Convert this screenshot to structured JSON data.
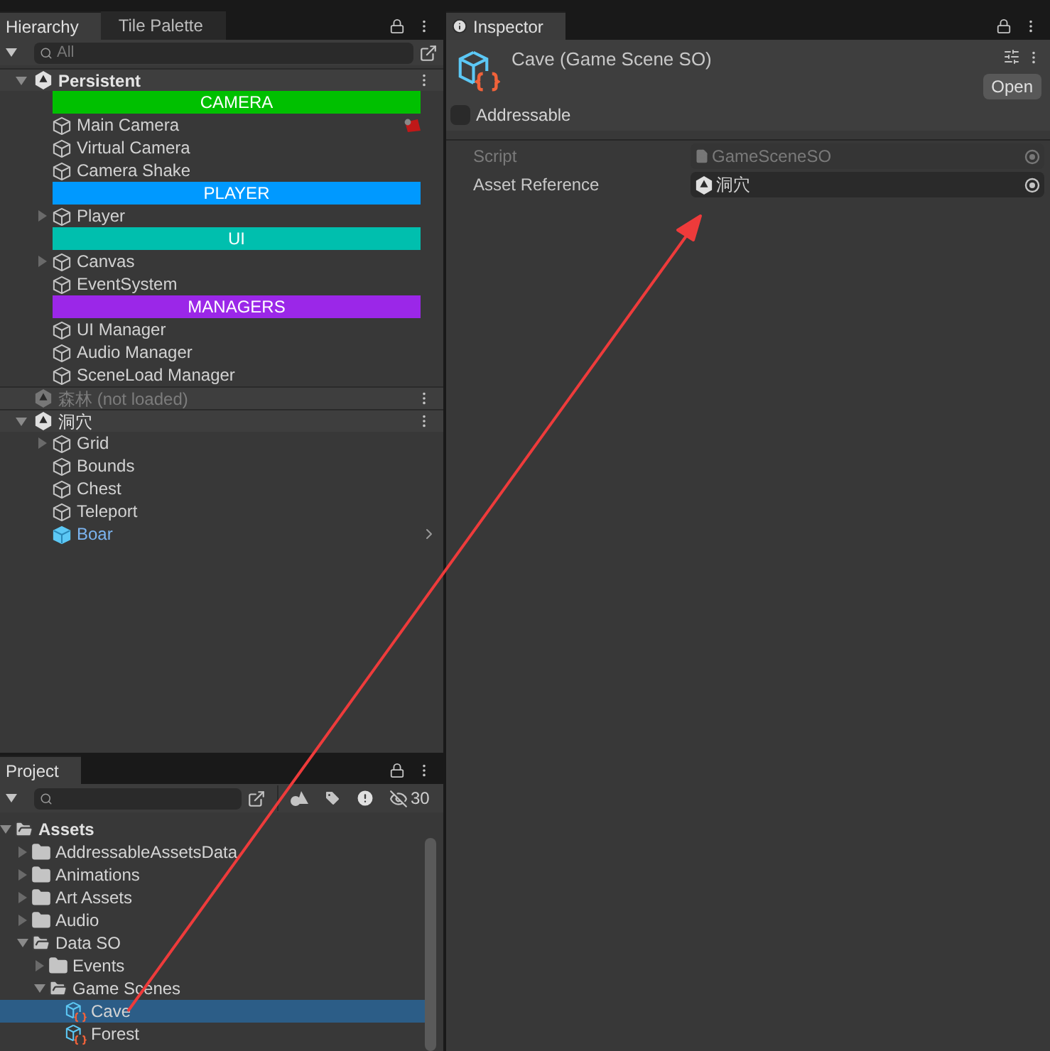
{
  "hierarchy": {
    "tabs": [
      {
        "label": "Hierarchy",
        "selected": true
      },
      {
        "label": "Tile Palette",
        "selected": false
      }
    ],
    "search": {
      "placeholder": "All"
    },
    "scenes": [
      {
        "name": "Persistent",
        "loaded": true,
        "expanded": true,
        "children": [
          {
            "kind": "header",
            "label": "CAMERA",
            "color": "#00c000"
          },
          {
            "kind": "object",
            "name": "Main Camera",
            "expandable": false,
            "prefab": false,
            "gizmo": true
          },
          {
            "kind": "object",
            "name": "Virtual Camera",
            "expandable": false,
            "prefab": false,
            "gizmo": false
          },
          {
            "kind": "object",
            "name": "Camera Shake",
            "expandable": false,
            "prefab": false,
            "gizmo": false
          },
          {
            "kind": "header",
            "label": "PLAYER",
            "color": "#0099ff"
          },
          {
            "kind": "object",
            "name": "Player",
            "expandable": true,
            "prefab": false,
            "gizmo": false
          },
          {
            "kind": "header",
            "label": "UI",
            "color": "#00bfae"
          },
          {
            "kind": "object",
            "name": "Canvas",
            "expandable": true,
            "prefab": false,
            "gizmo": false
          },
          {
            "kind": "object",
            "name": "EventSystem",
            "expandable": false,
            "prefab": false,
            "gizmo": false
          },
          {
            "kind": "header",
            "label": "MANAGERS",
            "color": "#9b27e8"
          },
          {
            "kind": "object",
            "name": "UI Manager",
            "expandable": false,
            "prefab": false,
            "gizmo": false
          },
          {
            "kind": "object",
            "name": "Audio Manager",
            "expandable": false,
            "prefab": false,
            "gizmo": false
          },
          {
            "kind": "object",
            "name": "SceneLoad Manager",
            "expandable": false,
            "prefab": false,
            "gizmo": false
          }
        ]
      },
      {
        "name": "森林 (not loaded)",
        "loaded": false
      },
      {
        "name": "洞穴",
        "loaded": true,
        "expanded": true,
        "children": [
          {
            "kind": "object",
            "name": "Grid",
            "expandable": true,
            "prefab": false,
            "gizmo": false
          },
          {
            "kind": "object",
            "name": "Bounds",
            "expandable": false,
            "prefab": false,
            "gizmo": false
          },
          {
            "kind": "object",
            "name": "Chest",
            "expandable": false,
            "prefab": false,
            "gizmo": false
          },
          {
            "kind": "object",
            "name": "Teleport",
            "expandable": false,
            "prefab": false,
            "gizmo": false
          },
          {
            "kind": "object",
            "name": "Boar",
            "expandable": false,
            "prefab": true,
            "gizmo": false
          }
        ]
      }
    ]
  },
  "project": {
    "tabs": [
      {
        "label": "Project",
        "selected": true
      }
    ],
    "hidden_count": "30",
    "items": [
      {
        "kind": "folder",
        "name": "Assets",
        "expanded": true,
        "selected": false,
        "children": [
          {
            "kind": "folder",
            "name": "AddressableAssetsData",
            "expanded": false,
            "selected": false
          },
          {
            "kind": "folder",
            "name": "Animations",
            "expanded": false,
            "selected": false
          },
          {
            "kind": "folder",
            "name": "Art Assets",
            "expanded": false,
            "selected": false
          },
          {
            "kind": "folder",
            "name": "Audio",
            "expanded": false,
            "selected": false
          },
          {
            "kind": "folder",
            "name": "Data SO",
            "expanded": true,
            "selected": false,
            "children": [
              {
                "kind": "folder",
                "name": "Events",
                "expanded": false,
                "selected": false
              },
              {
                "kind": "folder",
                "name": "Game Scenes",
                "expanded": true,
                "selected": false,
                "children": [
                  {
                    "kind": "asset",
                    "name": "Cave",
                    "selected": true
                  },
                  {
                    "kind": "asset",
                    "name": "Forest",
                    "selected": false
                  }
                ]
              }
            ]
          }
        ]
      }
    ]
  },
  "inspector": {
    "tabs": [
      {
        "label": "Inspector",
        "selected": true
      }
    ],
    "title": "Cave (Game Scene SO)",
    "open_button": "Open",
    "addressable": {
      "label": "Addressable",
      "checked": false
    },
    "fields": [
      {
        "kind": "script",
        "label": "Script",
        "value": "GameSceneSO",
        "disabled": true
      },
      {
        "kind": "scene",
        "label": "Asset Reference",
        "value": "洞穴",
        "disabled": false
      }
    ]
  }
}
